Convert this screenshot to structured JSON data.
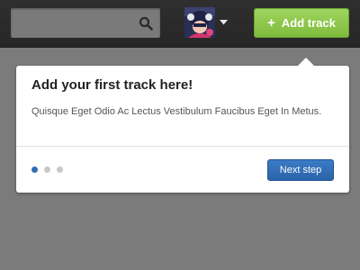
{
  "search": {
    "value": "",
    "placeholder": "",
    "icon": "search-icon"
  },
  "user_menu": {
    "avatar": "avatar",
    "caret_icon": "caret-down-icon"
  },
  "header": {
    "add_track_label": "Add track",
    "add_icon": "plus-icon",
    "accent": "#8cc84b"
  },
  "popover": {
    "title": "Add your first track here!",
    "body": "Quisque Eget Odio Ac Lectus Vestibulum Faucibus Eget In Metus.",
    "steps_total": 3,
    "current_step": 1,
    "next_label": "Next step",
    "next_color": "#2b6cb0"
  }
}
